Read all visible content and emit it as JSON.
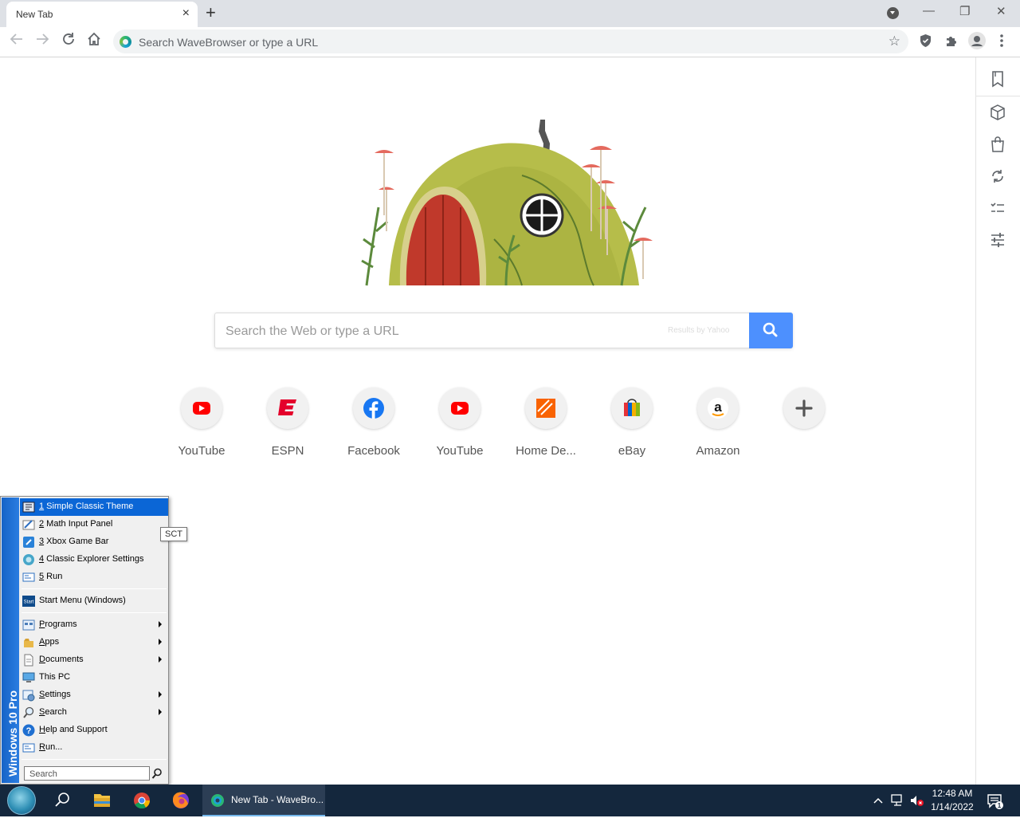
{
  "browser": {
    "tab_title": "New Tab",
    "tab_close": "×",
    "new_tab": "+",
    "minimize": "—",
    "restore": "❐",
    "close": "✕",
    "omnibox_placeholder": "Search WaveBrowser or type a URL"
  },
  "newtab": {
    "search_placeholder": "Search the Web or type a URL",
    "results_by": "Results by Yahoo",
    "tiles": [
      {
        "label": "YouTube",
        "icon": "youtube-icon"
      },
      {
        "label": "ESPN",
        "icon": "espn-icon"
      },
      {
        "label": "Facebook",
        "icon": "facebook-icon"
      },
      {
        "label": "YouTube",
        "icon": "youtube-icon"
      },
      {
        "label": "Home De...",
        "icon": "home-depot-icon"
      },
      {
        "label": "eBay",
        "icon": "ebay-icon"
      },
      {
        "label": "Amazon",
        "icon": "amazon-icon"
      },
      {
        "label": "",
        "icon": "add-icon"
      }
    ]
  },
  "sidebar": {
    "icons": [
      "bookmark-icon",
      "package-icon",
      "shopping-bag-icon",
      "sync-icon",
      "checklist-icon",
      "sliders-icon"
    ]
  },
  "start_menu": {
    "banner": "Windows 10 Pro",
    "recent": [
      {
        "num": "1",
        "label": " Simple Classic Theme"
      },
      {
        "num": "2",
        "label": " Math Input Panel"
      },
      {
        "num": "3",
        "label": " Xbox Game Bar"
      },
      {
        "num": "4",
        "label": " Classic Explorer Settings"
      },
      {
        "num": "5",
        "label": " Run"
      }
    ],
    "start_menu_windows": "Start Menu (Windows)",
    "items": [
      {
        "ul": "P",
        "rest": "rograms",
        "submenu": true
      },
      {
        "ul": "A",
        "rest": "pps",
        "submenu": true
      },
      {
        "ul": "D",
        "rest": "ocuments",
        "submenu": true
      },
      {
        "ul": "",
        "rest": "This PC",
        "submenu": false
      },
      {
        "ul": "S",
        "rest": "ettings",
        "submenu": true
      },
      {
        "ul": "S",
        "rest": "earch",
        "submenu": true
      },
      {
        "ul": "H",
        "rest": "elp and Support",
        "submenu": false
      },
      {
        "ul": "R",
        "rest": "un...",
        "submenu": false
      }
    ],
    "search_placeholder": "Search",
    "tooltip": "SCT",
    "start_icon_text": "Start"
  },
  "taskbar": {
    "active_window": "New Tab - WaveBro...",
    "time": "12:48 AM",
    "date": "1/14/2022",
    "notification_count": "1"
  },
  "colors": {
    "accent": "#4d90fe",
    "menu_selection": "#0b66d6",
    "banner": "#1663c7",
    "taskbar": "#14273d"
  }
}
